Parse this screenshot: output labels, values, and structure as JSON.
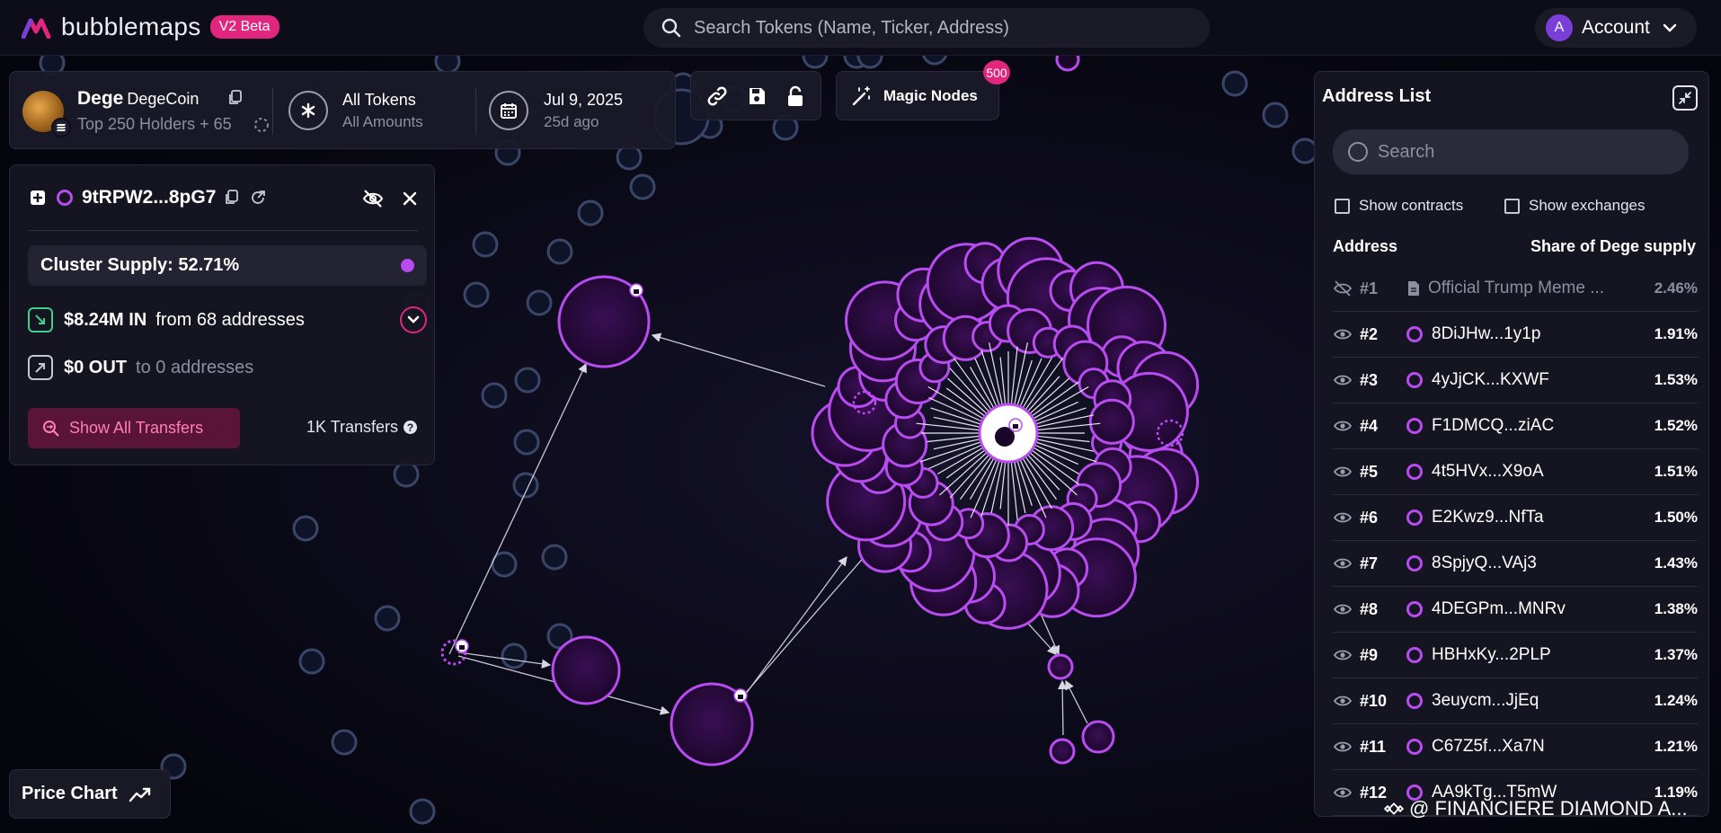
{
  "app": {
    "name": "bubblemaps",
    "beta_badge": "V2 Beta",
    "search_placeholder": "Search Tokens (Name, Ticker, Address)",
    "account_initial": "A",
    "account_label": "Account",
    "accent": "#b84cf0",
    "brand_pink": "#e0267f"
  },
  "token": {
    "symbol": "Dege",
    "name": "DegeCoin",
    "holders_label": "Top 250 Holders + 65",
    "filter_title": "All Tokens",
    "filter_sub": "All Amounts",
    "date": "Jul 9, 2025",
    "date_ago": "25d ago"
  },
  "toolbar": {
    "magic_nodes_label": "Magic Nodes",
    "magic_nodes_badge": "500"
  },
  "wallet": {
    "address": "9tRPW2...8pG7",
    "cluster_supply": "Cluster Supply: 52.71%",
    "in_amount": "$8.24M IN",
    "in_from": "from 68 addresses",
    "out_amount": "$0 OUT",
    "out_to": "to 0 addresses",
    "show_all_label": "Show All Transfers",
    "transfers_count": "1K Transfers"
  },
  "price_chart_label": "Price Chart",
  "address_list": {
    "title": "Address List",
    "search_placeholder": "Search",
    "show_contracts": "Show contracts",
    "show_exchanges": "Show exchanges",
    "col_address": "Address",
    "col_share": "Share of Dege supply",
    "rows": [
      {
        "rank": "#1",
        "name": "Official Trump Meme ...",
        "share": "2.46%"
      },
      {
        "rank": "#2",
        "name": "8DiJHw...1y1p",
        "share": "1.91%"
      },
      {
        "rank": "#3",
        "name": "4yJjCK...KXWF",
        "share": "1.53%"
      },
      {
        "rank": "#4",
        "name": "F1DMCQ...ziAC",
        "share": "1.52%"
      },
      {
        "rank": "#5",
        "name": "4t5HVx...X9oA",
        "share": "1.51%"
      },
      {
        "rank": "#6",
        "name": "E2Kwz9...NfTa",
        "share": "1.50%"
      },
      {
        "rank": "#7",
        "name": "8SpjyQ...VAj3",
        "share": "1.43%"
      },
      {
        "rank": "#8",
        "name": "4DEGPm...MNRv",
        "share": "1.38%"
      },
      {
        "rank": "#9",
        "name": "HBHxKy...2PLP",
        "share": "1.37%"
      },
      {
        "rank": "#10",
        "name": "3euycm...JjEq",
        "share": "1.24%"
      },
      {
        "rank": "#11",
        "name": "C67Z5f...Xa7N",
        "share": "1.21%"
      },
      {
        "rank": "#12",
        "name": "AA9kTg...T5mW",
        "share": "1.19%"
      }
    ]
  },
  "watermark": "@ FINANCIERE DIAMOND A..."
}
